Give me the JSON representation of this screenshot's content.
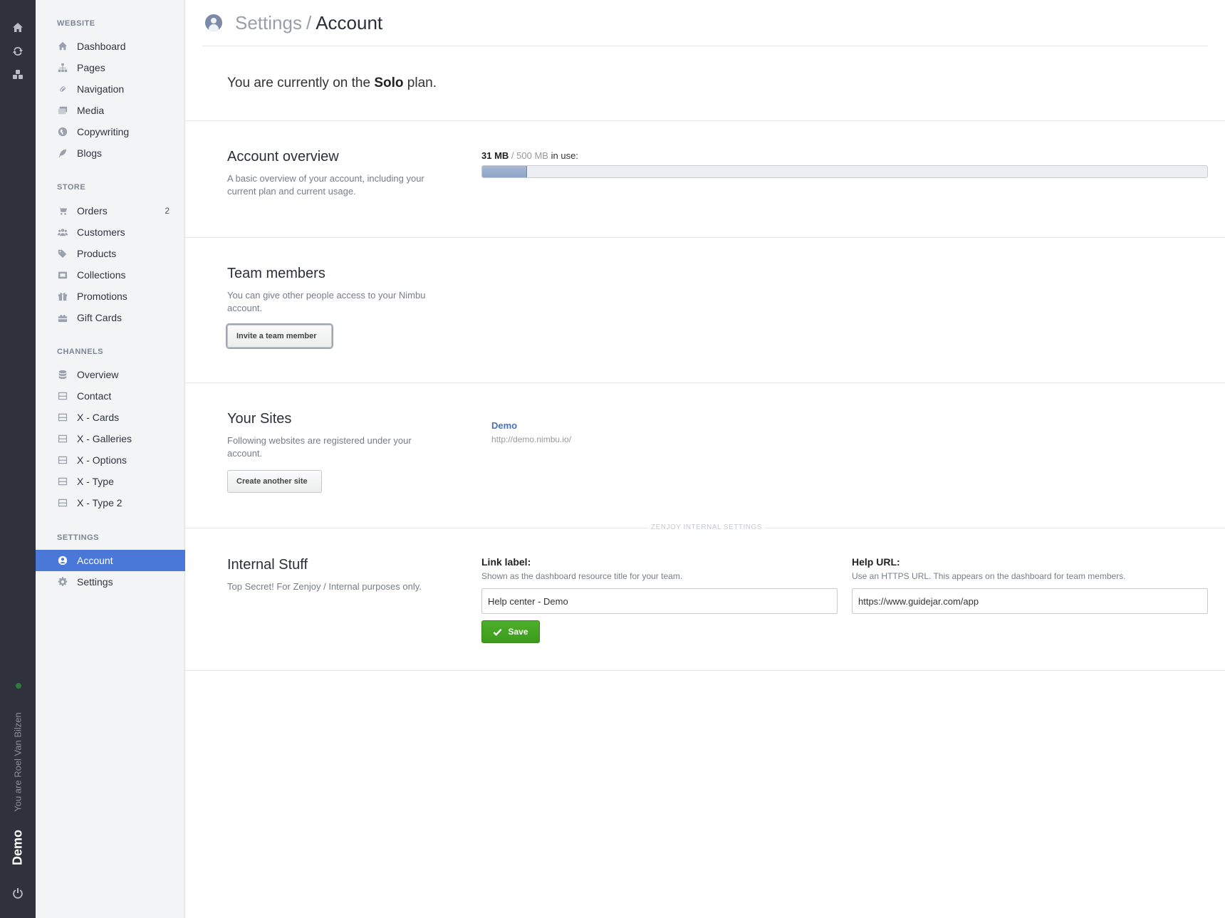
{
  "rail": {
    "user_text": "You are Roel Van Bilzen",
    "site_name": "Demo"
  },
  "sidebar": {
    "website": {
      "heading": "WEBSITE",
      "items": [
        {
          "label": "Dashboard",
          "icon": "home-icon"
        },
        {
          "label": "Pages",
          "icon": "sitemap-icon"
        },
        {
          "label": "Navigation",
          "icon": "link-icon"
        },
        {
          "label": "Media",
          "icon": "images-icon"
        },
        {
          "label": "Copywriting",
          "icon": "globe-icon"
        },
        {
          "label": "Blogs",
          "icon": "feather-icon"
        }
      ]
    },
    "store": {
      "heading": "STORE",
      "items": [
        {
          "label": "Orders",
          "icon": "cart-icon",
          "badge": "2"
        },
        {
          "label": "Customers",
          "icon": "users-icon"
        },
        {
          "label": "Products",
          "icon": "tags-icon"
        },
        {
          "label": "Collections",
          "icon": "collection-icon"
        },
        {
          "label": "Promotions",
          "icon": "gift-icon"
        },
        {
          "label": "Gift Cards",
          "icon": "giftcard-icon"
        }
      ]
    },
    "channels": {
      "heading": "CHANNELS",
      "items": [
        {
          "label": "Overview",
          "icon": "database-icon"
        },
        {
          "label": "Contact",
          "icon": "channel-icon"
        },
        {
          "label": "X - Cards",
          "icon": "channel-icon"
        },
        {
          "label": "X - Galleries",
          "icon": "channel-icon"
        },
        {
          "label": "X - Options",
          "icon": "channel-icon"
        },
        {
          "label": "X - Type",
          "icon": "channel-icon"
        },
        {
          "label": "X - Type 2",
          "icon": "channel-icon"
        }
      ]
    },
    "settings": {
      "heading": "SETTINGS",
      "items": [
        {
          "label": "Account",
          "icon": "user-circle-icon",
          "active": true
        },
        {
          "label": "Settings",
          "icon": "gear-icon"
        }
      ]
    }
  },
  "header": {
    "parent": "Settings",
    "separator": "/",
    "current": "Account"
  },
  "plan": {
    "prefix": "You are currently on the",
    "name": "Solo",
    "suffix": "plan."
  },
  "overview": {
    "title": "Account overview",
    "description": "A basic overview of your account, including your current plan and current usage.",
    "used": "31 MB",
    "separator": "/",
    "total": "500 MB",
    "suffix": "in use:",
    "usage_fraction": 0.062
  },
  "team": {
    "title": "Team members",
    "description": "You can give other people access to your Nimbu account.",
    "invite_label": "Invite a team member"
  },
  "sites": {
    "title": "Your Sites",
    "description": "Following websites are registered under your account.",
    "create_label": "Create another site",
    "list": [
      {
        "name": "Demo",
        "url": "http://demo.nimbu.io/"
      }
    ]
  },
  "internal": {
    "divider_label": "ZENJOY INTERNAL SETTINGS",
    "title": "Internal Stuff",
    "description": "Top Secret! For Zenjoy / Internal purposes only.",
    "link_label": {
      "label": "Link label:",
      "help": "Shown as the dashboard resource title for your team.",
      "value": "Help center - Demo"
    },
    "help_url": {
      "label": "Help URL:",
      "help": "Use an HTTPS URL. This appears on the dashboard for team members.",
      "value": "https://www.guidejar.com/app"
    },
    "save_label": "Save"
  },
  "colors": {
    "accent": "#4a78d9",
    "save_green": "#3c9b1c",
    "rail": "#2f323c"
  }
}
